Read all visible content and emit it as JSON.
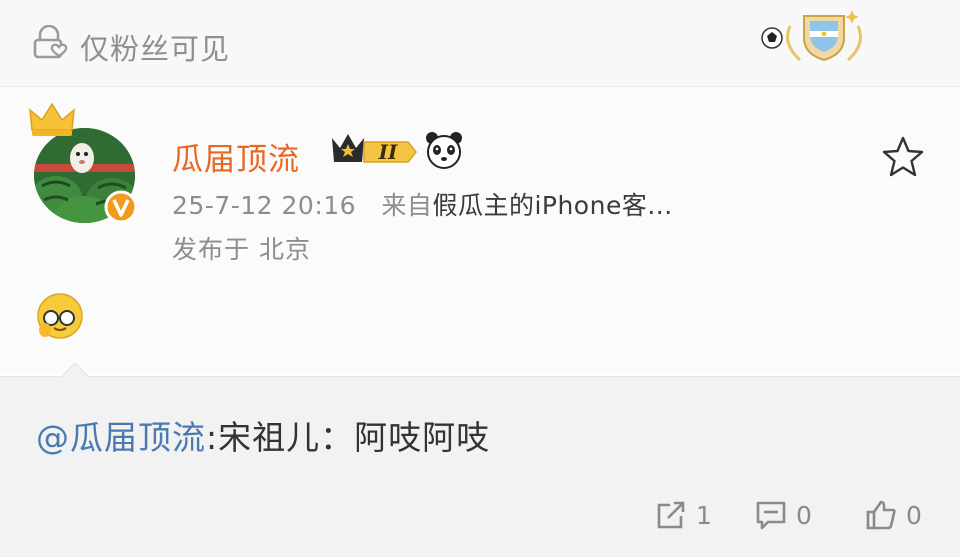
{
  "header": {
    "visibility_text": "仅粉丝可见",
    "lock_icon": "lock-heart-icon",
    "medal_icon": "football-shield-medal-icon"
  },
  "post": {
    "username": "瓜届顶流",
    "badges": [
      "crown-badge",
      "rank-badge",
      "panda-emoji"
    ],
    "rank_label": "II",
    "time": "25-7-12 20:16",
    "source_prefix": "来自",
    "source": "假瓜主的iPhone客...",
    "location": "发布于 北京",
    "emoji": "glasses-face-emoji",
    "favorite_icon": "star-outline-icon"
  },
  "quote": {
    "mention": "@瓜届顶流",
    "text": ":宋祖儿：阿吱阿吱"
  },
  "actions": {
    "repost_count": "1",
    "comment_count": "0",
    "like_count": "0"
  },
  "colors": {
    "username": "#e86722",
    "mention": "#4a7ab0",
    "muted": "#8d8d8d",
    "quote_bg": "#f2f2f2"
  }
}
